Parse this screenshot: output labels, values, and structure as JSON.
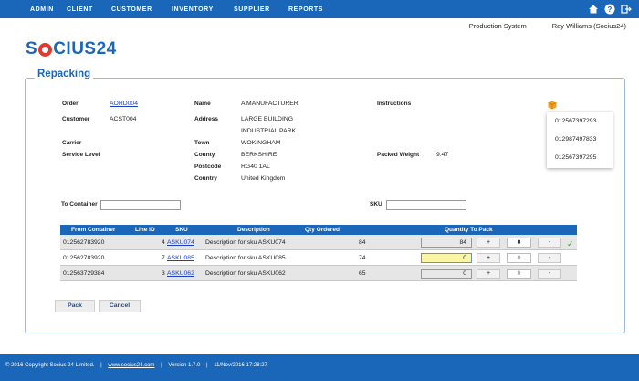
{
  "nav": {
    "items": [
      "ADMIN",
      "CLIENT",
      "CUSTOMER",
      "INVENTORY",
      "SUPPLIER",
      "REPORTS"
    ]
  },
  "system": {
    "name": "Production System",
    "user": "Ray Williams (Socius24)"
  },
  "logo": {
    "text_a": "S",
    "text_b": "CIUS24"
  },
  "panel": {
    "title": "Repacking"
  },
  "order": {
    "order_label": "Order",
    "order_value": "AORD004",
    "customer_label": "Customer",
    "customer_value": "ACST004",
    "carrier_label": "Carrier",
    "service_label": "Service Level"
  },
  "address": {
    "name_label": "Name",
    "name_value": "A MANUFACTURER",
    "address_label": "Address",
    "address_line1": "LARGE BUILDING",
    "address_line2": "INDUSTRIAL PARK",
    "town_label": "Town",
    "town_value": "WOKINGHAM",
    "county_label": "County",
    "county_value": "BERKSHIRE",
    "postcode_label": "Postcode",
    "postcode_value": "RG40 1AL",
    "country_label": "Country",
    "country_value": "United Kingdom"
  },
  "instructions": {
    "label": "Instructions",
    "packed_weight_label": "Packed Weight",
    "packed_weight_value": "9.47",
    "package_icon": "package-icon",
    "options": [
      "012567397293",
      "012987497833",
      "012567397295"
    ]
  },
  "filters": {
    "to_container_label": "To Container",
    "to_container_value": "",
    "sku_label": "SKU",
    "sku_value": ""
  },
  "table": {
    "headers": [
      "From Container",
      "Line ID",
      "SKU",
      "Description",
      "Qty Ordered",
      "Quantity To Pack"
    ],
    "rows": [
      {
        "from": "012562783920",
        "line": "4",
        "sku": "ASKU074",
        "desc": "Description for sku ASKU074",
        "qty": "84",
        "pack": "84",
        "count": "0",
        "plus": "+",
        "minus": "-",
        "done": "✓"
      },
      {
        "from": "012562783920",
        "line": "7",
        "sku": "ASKU085",
        "desc": "Description for sku ASKU085",
        "qty": "74",
        "pack": "0",
        "count": "0",
        "plus": "+",
        "minus": "-"
      },
      {
        "from": "012563729384",
        "line": "3",
        "sku": "ASKU062",
        "desc": "Description for sku ASKU062",
        "qty": "65",
        "pack": "0",
        "count": "0",
        "plus": "+",
        "minus": "-"
      }
    ]
  },
  "buttons": {
    "pack": "Pack",
    "cancel": "Cancel"
  },
  "footer": {
    "copyright": "© 2016 Copyright Socius 24 Limited.",
    "site": "www.socius24.com",
    "version": "Version 1.7.0",
    "datetime": "11/Nov/2016 17:28:27"
  },
  "colors": {
    "brand": "#1a66b8",
    "accent_red": "#e33a2f",
    "active_field": "#fbf6a4",
    "check": "#2fa52f"
  }
}
